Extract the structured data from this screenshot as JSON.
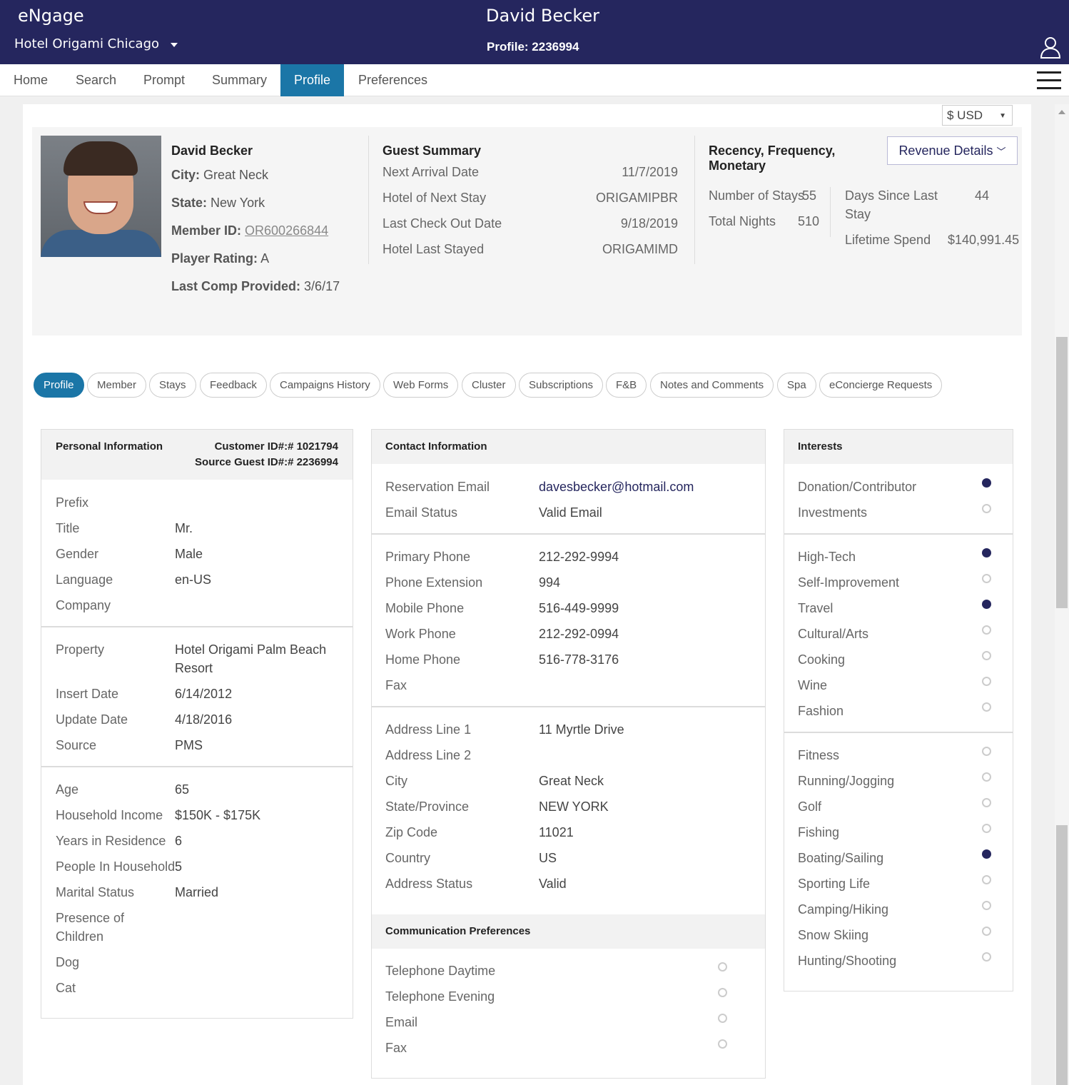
{
  "header": {
    "brand": "eNgage",
    "hotel": "Hotel Origami Chicago",
    "guest_name": "David Becker",
    "profile_label": "Profile: 2236994"
  },
  "nav": [
    "Home",
    "Search",
    "Prompt",
    "Summary",
    "Profile",
    "Preferences"
  ],
  "currency": "$ USD",
  "guest": {
    "name": "David Becker",
    "city_label": "City:",
    "city": "Great Neck",
    "state_label": "State:",
    "state": "New York",
    "member_label": "Member ID:",
    "member_id": "OR600266844",
    "rating_label": "Player Rating:",
    "rating": "A",
    "comp_label": "Last Comp Provided:",
    "comp": "3/6/17"
  },
  "guest_summary": {
    "title": "Guest Summary",
    "rows": [
      {
        "label": "Next Arrival Date",
        "value": "11/7/2019"
      },
      {
        "label": "Hotel of Next Stay",
        "value": "ORIGAMIPBR"
      },
      {
        "label": "Last Check Out Date",
        "value": "9/18/2019"
      },
      {
        "label": "Hotel Last Stayed",
        "value": "ORIGAMIMD"
      }
    ]
  },
  "rfm": {
    "title": "Recency, Frequency, Monetary",
    "stays_label": "Number of Stays",
    "stays": "55",
    "nights_label": "Total Nights",
    "nights": "510",
    "days_label": "Days Since Last Stay",
    "days": "44",
    "spend_label": "Lifetime Spend",
    "spend": "$140,991.45",
    "revenue_button": "Revenue Details"
  },
  "tabs": [
    "Profile",
    "Member",
    "Stays",
    "Feedback",
    "Campaigns History",
    "Web Forms",
    "Cluster",
    "Subscriptions",
    "F&B",
    "Notes and Comments",
    "Spa",
    "eConcierge Requests"
  ],
  "personal": {
    "title": "Personal Information",
    "customer_id": "Customer ID#:# 1021794",
    "source_id": "Source Guest ID#:# 2236994",
    "group1": [
      {
        "label": "Prefix",
        "value": ""
      },
      {
        "label": "Title",
        "value": "Mr."
      },
      {
        "label": "Gender",
        "value": "Male"
      },
      {
        "label": "Language",
        "value": "en-US"
      },
      {
        "label": "Company",
        "value": ""
      }
    ],
    "property_label": "Property",
    "property_line1": "Hotel Origami Palm Beach",
    "property_line2": "Resort",
    "group2": [
      {
        "label": "Insert Date",
        "value": "6/14/2012"
      },
      {
        "label": "Update Date",
        "value": "4/18/2016"
      },
      {
        "label": "Source",
        "value": "PMS"
      }
    ],
    "group3": [
      {
        "label": "Age",
        "value": "65"
      },
      {
        "label": "Household Income",
        "value": "$150K - $175K"
      },
      {
        "label": "Years in Residence",
        "value": "6"
      },
      {
        "label": "People In Household",
        "value": "5"
      },
      {
        "label": "Marital Status",
        "value": "Married"
      }
    ],
    "children_line1": "Presence of",
    "children_line2": "Children",
    "dog": "Dog",
    "cat": "Cat"
  },
  "contact": {
    "title": "Contact Information",
    "group1": [
      {
        "label": "Reservation Email",
        "value": "davesbecker@hotmail.com"
      },
      {
        "label": "Email Status",
        "value": "Valid Email"
      }
    ],
    "group2": [
      {
        "label": "Primary Phone",
        "value": "212-292-9994"
      },
      {
        "label": "Phone Extension",
        "value": "994"
      },
      {
        "label": "Mobile Phone",
        "value": "516-449-9999"
      },
      {
        "label": "Work Phone",
        "value": "212-292-0994"
      },
      {
        "label": "Home Phone",
        "value": "516-778-3176"
      },
      {
        "label": "Fax",
        "value": ""
      }
    ],
    "group3": [
      {
        "label": "Address Line 1",
        "value": "11 Myrtle Drive"
      },
      {
        "label": "Address Line 2",
        "value": ""
      },
      {
        "label": "City",
        "value": "Great Neck"
      },
      {
        "label": "State/Province",
        "value": "NEW YORK"
      },
      {
        "label": "Zip Code",
        "value": "11021"
      },
      {
        "label": "Country",
        "value": "US"
      },
      {
        "label": "Address Status",
        "value": "Valid"
      }
    ],
    "comm_title": "Communication Preferences",
    "comm": [
      {
        "label": "Telephone Daytime",
        "on": false
      },
      {
        "label": "Telephone Evening",
        "on": false
      },
      {
        "label": "Email",
        "on": false
      },
      {
        "label": "Fax",
        "on": false
      }
    ]
  },
  "interests": {
    "title": "Interests",
    "group1": [
      {
        "label": "Donation/Contributor",
        "on": true
      },
      {
        "label": "Investments",
        "on": false
      }
    ],
    "group2": [
      {
        "label": "High-Tech",
        "on": true
      },
      {
        "label": "Self-Improvement",
        "on": false
      },
      {
        "label": "Travel",
        "on": true
      },
      {
        "label": "Cultural/Arts",
        "on": false
      },
      {
        "label": "Cooking",
        "on": false
      },
      {
        "label": "Wine",
        "on": false
      },
      {
        "label": "Fashion",
        "on": false
      }
    ],
    "group3": [
      {
        "label": "Fitness",
        "on": false
      },
      {
        "label": "Running/Jogging",
        "on": false
      },
      {
        "label": "Golf",
        "on": false
      },
      {
        "label": "Fishing",
        "on": false
      },
      {
        "label": "Boating/Sailing",
        "on": true
      },
      {
        "label": "Sporting Life",
        "on": false
      },
      {
        "label": "Camping/Hiking",
        "on": false
      },
      {
        "label": "Snow Skiing",
        "on": false
      },
      {
        "label": "Hunting/Shooting",
        "on": false
      }
    ]
  },
  "colors": {
    "header": "#25265e",
    "active_tab": "#1b76a7",
    "dot_on": "#25265e"
  }
}
